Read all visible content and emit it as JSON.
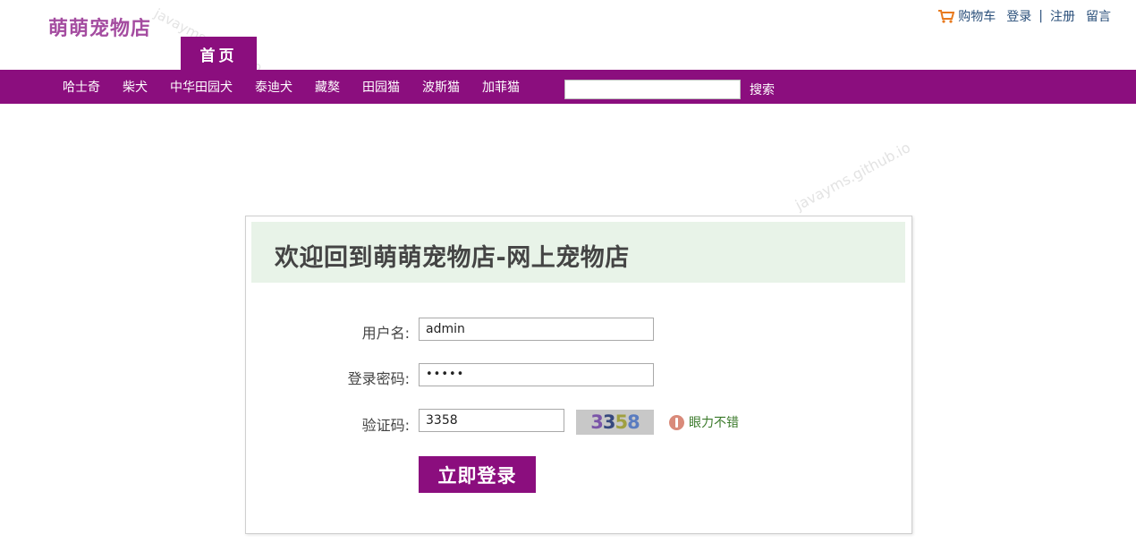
{
  "brand": {
    "logo_text": "萌萌宠物店"
  },
  "watermark": "javayms.github.io",
  "top_links": {
    "cart": "购物车",
    "login": "登录",
    "separator": "|",
    "register": "注册",
    "message": "留言"
  },
  "home_tab": "首页",
  "nav": {
    "items": [
      "哈士奇",
      "柴犬",
      "中华田园犬",
      "泰迪犬",
      "藏獒",
      "田园猫",
      "波斯猫",
      "加菲猫"
    ],
    "search_label": "搜索"
  },
  "login_panel": {
    "title": "欢迎回到萌萌宠物店-网上宠物店",
    "username_label": "用户名:",
    "username_value": "admin",
    "password_label": "登录密码:",
    "password_mask": "•••••",
    "captcha_label": "验证码:",
    "captcha_value": "3358",
    "captcha_image_text": "3358",
    "captcha_hint": "眼力不错",
    "submit_label": "立即登录"
  },
  "colors": {
    "brand_purple": "#8b0e7e",
    "logo_purple": "#a44ca0",
    "header_green": "#e8f3e8"
  }
}
